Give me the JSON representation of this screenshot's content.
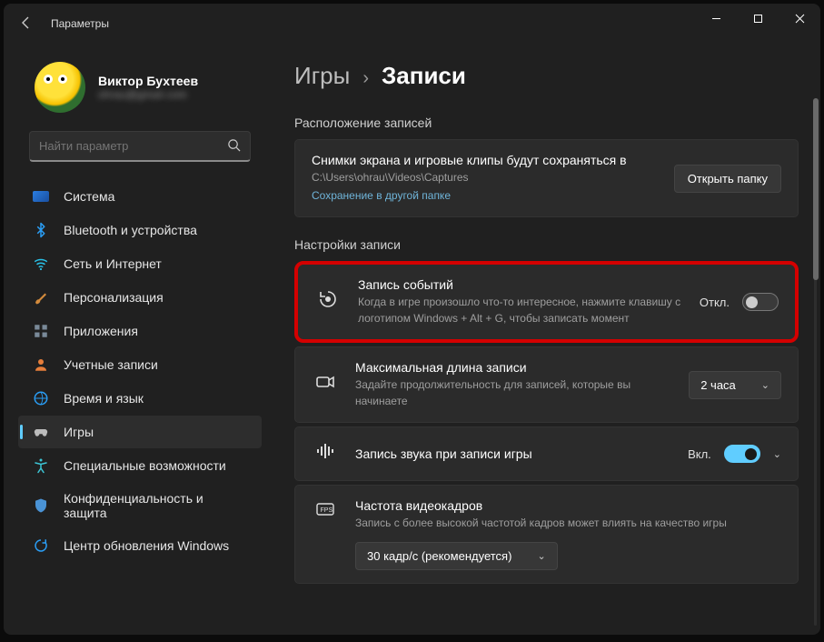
{
  "window": {
    "title": "Параметры"
  },
  "profile": {
    "name": "Виктор Бухтеев",
    "email_masked": "ohrau@gmail.com"
  },
  "search": {
    "placeholder": "Найти параметр"
  },
  "sidebar": {
    "items": [
      {
        "id": "system",
        "label": "Система"
      },
      {
        "id": "bluetooth",
        "label": "Bluetooth и устройства"
      },
      {
        "id": "network",
        "label": "Сеть и Интернет"
      },
      {
        "id": "personalization",
        "label": "Персонализация"
      },
      {
        "id": "apps",
        "label": "Приложения"
      },
      {
        "id": "accounts",
        "label": "Учетные записи"
      },
      {
        "id": "time",
        "label": "Время и язык"
      },
      {
        "id": "gaming",
        "label": "Игры",
        "active": true
      },
      {
        "id": "accessibility",
        "label": "Специальные возможности"
      },
      {
        "id": "privacy",
        "label": "Конфиденциальность и защита"
      },
      {
        "id": "update",
        "label": "Центр обновления Windows"
      }
    ]
  },
  "breadcrumb": {
    "parent": "Игры",
    "current": "Записи"
  },
  "sections": {
    "location": {
      "header": "Расположение записей",
      "desc": "Снимки экрана и игровые клипы будут сохраняться в",
      "path": "C:\\Users\\ohrau\\Videos\\Captures",
      "alt_link": "Сохранение в другой папке",
      "open_btn": "Открыть папку"
    },
    "settings": {
      "header": "Настройки записи",
      "capture": {
        "title": "Запись событий",
        "sub": "Когда в игре произошло что-то интересное, нажмите клавишу с логотипом Windows + Alt + G, чтобы записать момент",
        "state_label": "Откл.",
        "on": false
      },
      "maxlen": {
        "title": "Максимальная длина записи",
        "sub": "Задайте продолжительность для записей, которые вы начинаете",
        "value": "2 часа"
      },
      "audio": {
        "title": "Запись звука при записи игры",
        "state_label": "Вкл.",
        "on": true
      },
      "fps": {
        "title": "Частота видеокадров",
        "sub": "Запись с более высокой частотой кадров может влиять на качество игры",
        "value": "30 кадр/с (рекомендуется)"
      }
    }
  }
}
